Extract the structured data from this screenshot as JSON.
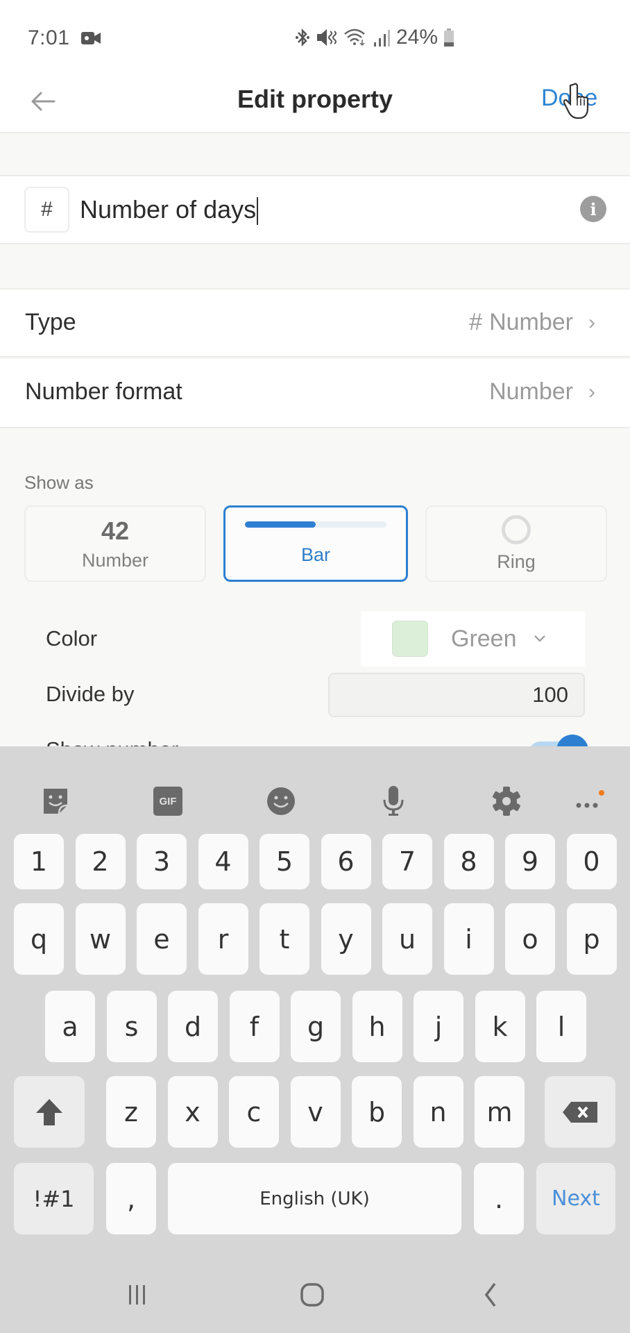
{
  "status_bar": {
    "time": "7:01",
    "battery_percent": "24%",
    "icons": [
      "video-camera-icon",
      "bluetooth-icon",
      "vibrate-mute-icon",
      "wifi-icon",
      "signal-icon",
      "battery-icon"
    ]
  },
  "header": {
    "back_icon": "arrow-left-icon",
    "title": "Edit property",
    "done_label": "Done"
  },
  "property": {
    "type_icon": "#",
    "name": "Number of days",
    "info_icon": "i"
  },
  "rows": [
    {
      "label": "Type",
      "value_icon": "#",
      "value": "Number"
    },
    {
      "label": "Number format",
      "value": "Number"
    }
  ],
  "show_as": {
    "label": "Show as",
    "options": [
      {
        "preview": "42",
        "label": "Number",
        "selected": false
      },
      {
        "label": "Bar",
        "selected": true,
        "preview_progress": 0.5
      },
      {
        "label": "Ring",
        "selected": false
      }
    ]
  },
  "options": {
    "color_label": "Color",
    "color_value": "Green",
    "color_swatch": "#dcefd9",
    "divide_label": "Divide by",
    "divide_value": "100",
    "show_number_label": "Show number",
    "show_number_on": true
  },
  "keyboard": {
    "toolbar": [
      "sticker-icon",
      "gif-icon",
      "emoji-icon",
      "microphone-icon",
      "settings-icon",
      "more-icon"
    ],
    "gif_label": "GIF",
    "row_numbers": [
      "1",
      "2",
      "3",
      "4",
      "5",
      "6",
      "7",
      "8",
      "9",
      "0"
    ],
    "row_top": [
      "q",
      "w",
      "e",
      "r",
      "t",
      "y",
      "u",
      "i",
      "o",
      "p"
    ],
    "row_mid": [
      "a",
      "s",
      "d",
      "f",
      "g",
      "h",
      "j",
      "k",
      "l"
    ],
    "row_bottom": [
      "z",
      "x",
      "c",
      "v",
      "b",
      "n",
      "m"
    ],
    "symbols_label": "!#1",
    "comma": ",",
    "space_label": "English (UK)",
    "period": ".",
    "action_label": "Next"
  },
  "colors": {
    "accent": "#2d7fd1",
    "background": "#f8f9f6",
    "keyboard_bg": "#d6d6d6",
    "notification_dot": "#f07a1c"
  }
}
